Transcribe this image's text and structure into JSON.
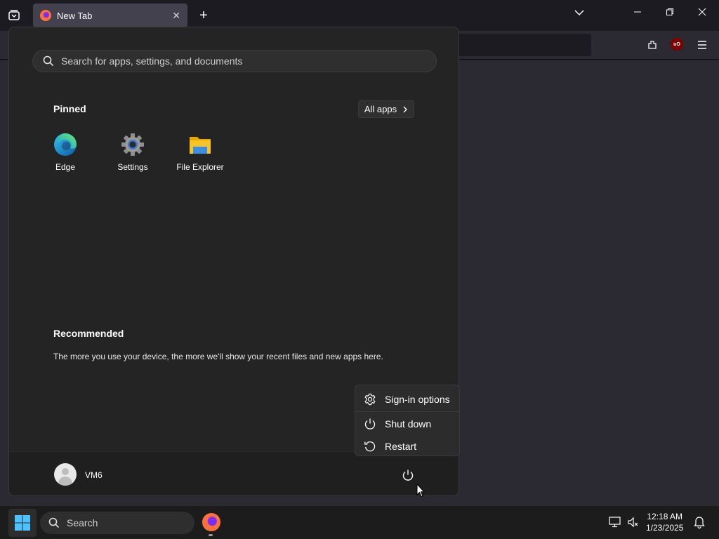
{
  "browser": {
    "tab_title": "New Tab",
    "new_tab_symbol": "+",
    "close_symbol": "✕",
    "list_tabs_symbol": "⌄"
  },
  "start_menu": {
    "search_placeholder": "Search for apps, settings, and documents",
    "pinned_title": "Pinned",
    "all_apps_label": "All apps",
    "apps": [
      {
        "label": "Edge",
        "icon": "edge-icon"
      },
      {
        "label": "Settings",
        "icon": "settings-gear-icon"
      },
      {
        "label": "File Explorer",
        "icon": "folder-icon"
      }
    ],
    "recommended_title": "Recommended",
    "recommended_text": "The more you use your device, the more we'll show your recent files and new apps here.",
    "user_name": "VM6"
  },
  "power_menu": {
    "items": [
      {
        "label": "Sign-in options",
        "icon": "gear-icon"
      },
      {
        "label": "Shut down",
        "icon": "power-icon"
      },
      {
        "label": "Restart",
        "icon": "restart-icon"
      }
    ]
  },
  "taskbar": {
    "search_label": "Search",
    "time": "12:18 AM",
    "date": "1/23/2025"
  },
  "colors": {
    "accent": "#0a84ff",
    "start_bg": "#242424",
    "taskbar_bg": "#1c1c1c",
    "folder_yellow": "#f7c325"
  }
}
